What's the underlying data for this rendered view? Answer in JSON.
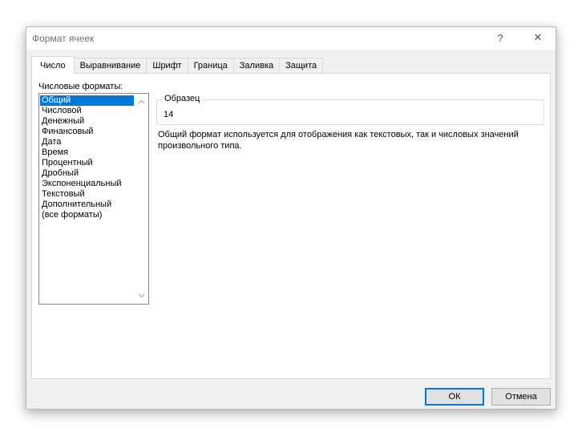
{
  "window": {
    "title": "Формат ячеек",
    "help_glyph": "?",
    "close_glyph": "✕"
  },
  "tabs": [
    {
      "label": "Число",
      "active": true
    },
    {
      "label": "Выравнивание",
      "active": false
    },
    {
      "label": "Шрифт",
      "active": false
    },
    {
      "label": "Граница",
      "active": false
    },
    {
      "label": "Заливка",
      "active": false
    },
    {
      "label": "Защита",
      "active": false
    }
  ],
  "formats": {
    "label": "Числовые форматы:",
    "selected_index": 0,
    "items": [
      "Общий",
      "Числовой",
      "Денежный",
      "Финансовый",
      "Дата",
      "Время",
      "Процентный",
      "Дробный",
      "Экспоненциальный",
      "Текстовый",
      "Дополнительный",
      "(все форматы)"
    ],
    "scroll_up_icon": "chevron-up-icon",
    "scroll_down_icon": "chevron-down-icon"
  },
  "sample": {
    "legend": "Образец",
    "value": "14"
  },
  "description": "Общий формат используется для отображения как текстовых, так и числовых значений произвольного типа.",
  "buttons": {
    "ok": "ОК",
    "cancel": "Отмена"
  },
  "colors": {
    "selection": "#0078d7",
    "dialog_bg": "#f0f0f0"
  }
}
